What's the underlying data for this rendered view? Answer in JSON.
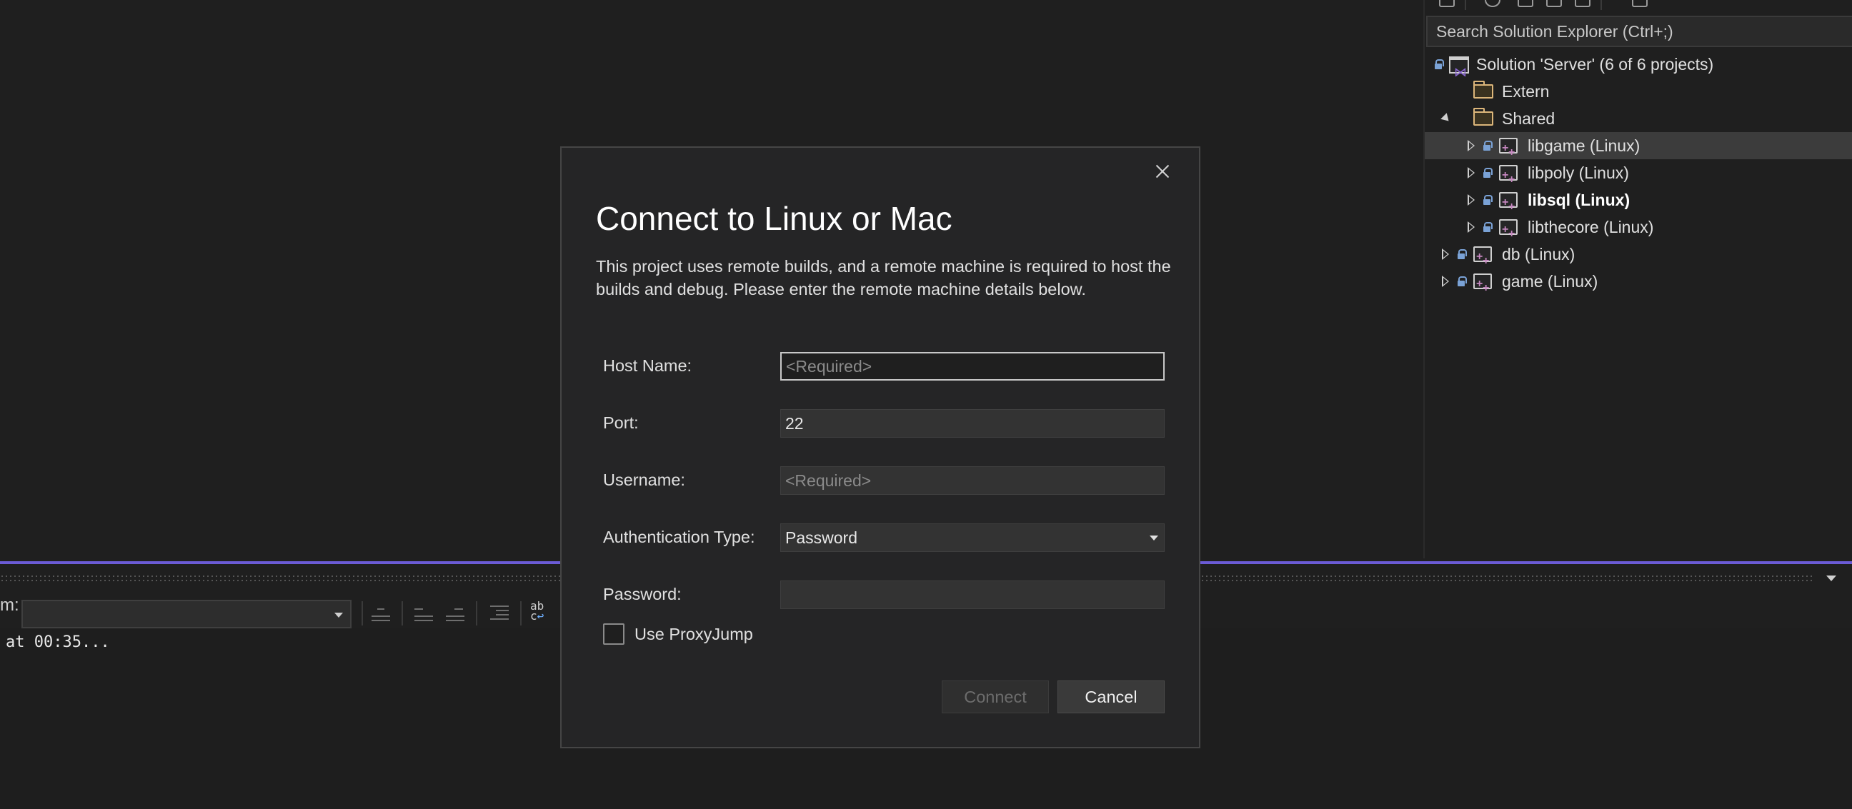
{
  "solution_explorer": {
    "search_placeholder": "Search Solution Explorer (Ctrl+;)",
    "solution_label": "Solution 'Server' (6 of 6 projects)",
    "items": [
      {
        "label": "Extern"
      },
      {
        "label": "Shared"
      },
      {
        "label": "libgame (Linux)"
      },
      {
        "label": "libpoly (Linux)"
      },
      {
        "label": "libsql (Linux)"
      },
      {
        "label": "libthecore (Linux)"
      },
      {
        "label": "db (Linux)"
      },
      {
        "label": "game (Linux)"
      }
    ]
  },
  "output_panel": {
    "from_label": "m:",
    "log_line": "at 00:35..."
  },
  "dialog": {
    "title": "Connect to Linux or Mac",
    "description": "This project uses remote builds, and a remote machine is required to host the builds and debug. Please enter the remote machine details below.",
    "fields": {
      "host_name": {
        "label": "Host Name:",
        "placeholder": "<Required>"
      },
      "port": {
        "label": "Port:",
        "value": "22"
      },
      "username": {
        "label": "Username:",
        "placeholder": "<Required>"
      },
      "auth_type": {
        "label": "Authentication Type:",
        "value": "Password"
      },
      "password": {
        "label": "Password:",
        "value": ""
      }
    },
    "proxy_jump_label": "Use ProxyJump",
    "connect_label": "Connect",
    "cancel_label": "Cancel"
  },
  "colors": {
    "accent": "#6b5bd6",
    "background": "#1f1f1f",
    "dialog_background": "#252526"
  }
}
